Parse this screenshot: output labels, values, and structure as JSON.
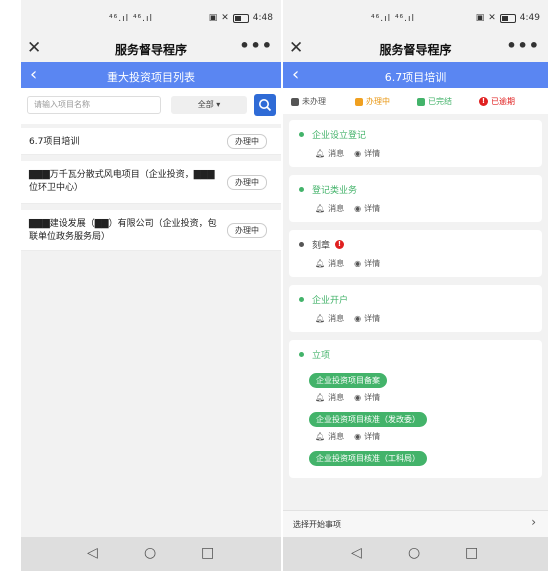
{
  "colors": {
    "accent": "#5a86f2",
    "search_button": "#2f6bd6",
    "not_done": "#555555",
    "in_progress": "#f0a020",
    "done": "#43b36a",
    "overdue": "#e02020"
  },
  "left": {
    "status_bar": {
      "signal": "⁴⁶.ıl ⁴⁶.ıl",
      "time": "4:48"
    },
    "app_title": "服务督导程序",
    "page_title": "重大投资项目列表",
    "search": {
      "placeholder": "请输入项目名称",
      "filter_value": "全部"
    },
    "projects": [
      {
        "name": "6.7项目培训",
        "status": "办理中"
      },
      {
        "name": "▇▇▇万千瓦分散式风电项目（企业投资，▇▇▇位环卫中心）",
        "status": "办理中"
      },
      {
        "name": "▇▇▇建设发展（▇▇）有限公司（企业投资，包联单位政务服务局）",
        "status": "办理中"
      }
    ]
  },
  "right": {
    "status_bar": {
      "signal": "⁴⁶.ıl ⁴⁶.ıl",
      "time": "4:49"
    },
    "app_title": "服务督导程序",
    "page_title": "6.7项目培训",
    "legend": {
      "not_done": "未办理",
      "in_progress": "办理中",
      "done": "已完结",
      "overdue": "已逾期"
    },
    "actions": {
      "message": "消息",
      "detail": "详情"
    },
    "steps": [
      {
        "title": "企业设立登记"
      },
      {
        "title": "登记类业务"
      },
      {
        "title": "刻章"
      },
      {
        "title": "企业开户"
      },
      {
        "title": "立项",
        "subs": [
          "企业投资项目备案",
          "企业投资项目核准（发改委）",
          "企业投资项目核准（工科局）"
        ]
      }
    ],
    "footer": {
      "label": "选择开始事项"
    }
  }
}
